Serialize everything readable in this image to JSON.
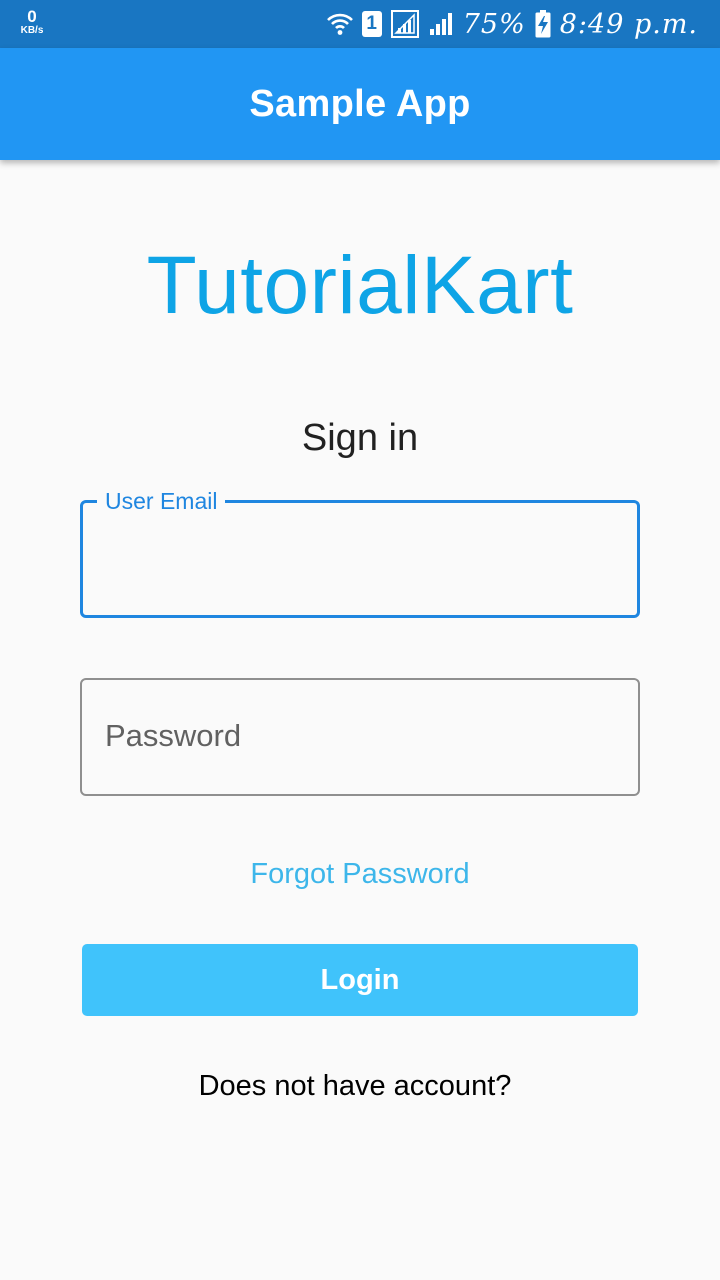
{
  "status_bar": {
    "net_speed_value": "0",
    "net_speed_unit": "KB/s",
    "sim_slot": "1",
    "battery_percent": "75%",
    "time": "8:49 p.m.",
    "icons": [
      "wifi-icon",
      "sim-1-icon",
      "signal-icon",
      "signal-icon",
      "battery-charging-icon"
    ],
    "background_color": "#1976c2"
  },
  "app_bar": {
    "title": "Sample App",
    "background_color": "#2196f3"
  },
  "main": {
    "brand": "TutorialKart",
    "heading": "Sign in",
    "email_label": "User Email",
    "email_value": "",
    "password_placeholder": "Password",
    "forgot_password": "Forgot Password",
    "login_button": "Login",
    "signup_prompt": "Does not have account?"
  },
  "colors": {
    "brand": "#0ea4e6",
    "focus_border": "#1f86e0",
    "link": "#3db6ea",
    "button": "#40c3fb"
  }
}
